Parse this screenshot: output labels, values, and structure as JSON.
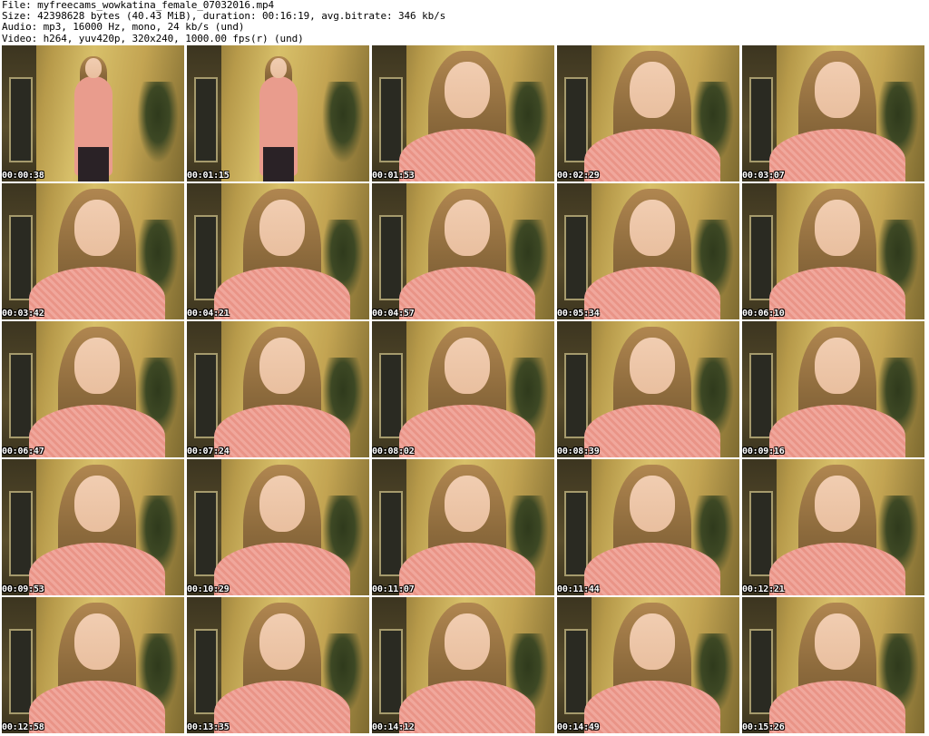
{
  "header": {
    "file_line": "File: myfreecams_wowkatina_female_07032016.mp4",
    "size_line": "Size: 42398628 bytes (40.43 MiB), duration: 00:16:19, avg.bitrate: 346 kb/s",
    "audio_line": "Audio: mp3, 16000 Hz, mono, 24 kb/s (und)",
    "video_line": "Video: h264, yuv420p, 320x240, 1000.00 fps(r) (und)"
  },
  "thumbnails": [
    {
      "timestamp": "00:00:38",
      "scene": "full-body-back"
    },
    {
      "timestamp": "00:01:15",
      "scene": "full-body-front"
    },
    {
      "timestamp": "00:01:53",
      "scene": "close-up"
    },
    {
      "timestamp": "00:02:29",
      "scene": "close-up"
    },
    {
      "timestamp": "00:03:07",
      "scene": "close-up"
    },
    {
      "timestamp": "00:03:42",
      "scene": "close-up"
    },
    {
      "timestamp": "00:04:21",
      "scene": "close-up"
    },
    {
      "timestamp": "00:04:57",
      "scene": "close-up"
    },
    {
      "timestamp": "00:05:34",
      "scene": "close-up"
    },
    {
      "timestamp": "00:06:10",
      "scene": "close-up"
    },
    {
      "timestamp": "00:06:47",
      "scene": "close-up"
    },
    {
      "timestamp": "00:07:24",
      "scene": "close-up"
    },
    {
      "timestamp": "00:08:02",
      "scene": "close-up"
    },
    {
      "timestamp": "00:08:39",
      "scene": "close-up"
    },
    {
      "timestamp": "00:09:16",
      "scene": "close-up"
    },
    {
      "timestamp": "00:09:53",
      "scene": "close-up"
    },
    {
      "timestamp": "00:10:29",
      "scene": "close-up"
    },
    {
      "timestamp": "00:11:07",
      "scene": "close-up"
    },
    {
      "timestamp": "00:11:44",
      "scene": "close-up"
    },
    {
      "timestamp": "00:12:21",
      "scene": "close-up"
    },
    {
      "timestamp": "00:12:58",
      "scene": "close-up"
    },
    {
      "timestamp": "00:13:35",
      "scene": "close-up"
    },
    {
      "timestamp": "00:14:12",
      "scene": "close-up"
    },
    {
      "timestamp": "00:14:49",
      "scene": "close-up"
    },
    {
      "timestamp": "00:15:26",
      "scene": "close-up"
    }
  ]
}
